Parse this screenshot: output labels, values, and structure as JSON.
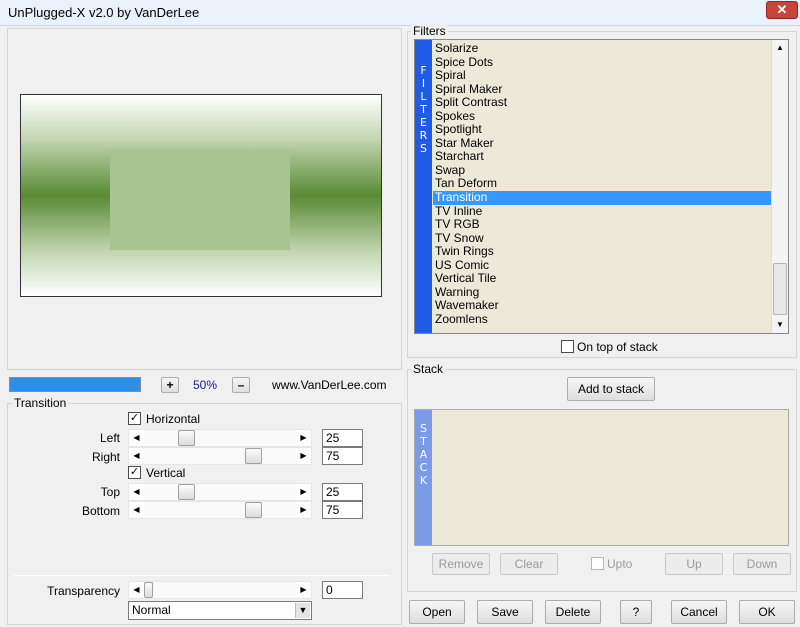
{
  "window": {
    "title": "UnPlugged-X v2.0 by VanDerLee",
    "close_glyph": "✕"
  },
  "preview": {
    "zoom_in": "+",
    "zoom_value": "50%",
    "zoom_out": "–",
    "website": "www.VanDerLee.com"
  },
  "transition_group": {
    "label": "Transition",
    "horizontal": {
      "label": "Horizontal",
      "checked": true
    },
    "vertical": {
      "label": "Vertical",
      "checked": true
    },
    "sliders": [
      {
        "label": "Left",
        "value": "25"
      },
      {
        "label": "Right",
        "value": "75"
      },
      {
        "label": "Top",
        "value": "25"
      },
      {
        "label": "Bottom",
        "value": "75"
      }
    ],
    "transparency": {
      "label": "Transparency",
      "value": "0"
    },
    "blend_mode": "Normal",
    "check_glyph": "✓"
  },
  "filters": {
    "label": "Filters",
    "sidebar_letters": [
      "F",
      "I",
      "L",
      "T",
      "E",
      "R",
      "S"
    ],
    "items": [
      "Solarize",
      "Spice Dots",
      "Spiral",
      "Spiral Maker",
      "Split Contrast",
      "Spokes",
      "Spotlight",
      "Star Maker",
      "Starchart",
      "Swap",
      "Tan Deform",
      "Transition",
      "TV Inline",
      "TV RGB",
      "TV Snow",
      "Twin Rings",
      "US Comic",
      "Vertical Tile",
      "Warning",
      "Wavemaker",
      "Zoomlens"
    ],
    "selected": "Transition",
    "on_top_of_stack": "On top of stack"
  },
  "stack": {
    "label": "Stack",
    "add_button": "Add to stack",
    "sidebar_letters": [
      "S",
      "T",
      "A",
      "C",
      "K"
    ],
    "remove": "Remove",
    "clear": "Clear",
    "upto": "Upto",
    "up": "Up",
    "down": "Down"
  },
  "footer": {
    "open": "Open",
    "save": "Save",
    "delete": "Delete",
    "help": "?",
    "cancel": "Cancel",
    "ok": "OK"
  },
  "colors": {
    "accent_blue": "#1e5be6",
    "selection": "#3399ff",
    "list_bg": "#ece9d8",
    "preview_green_dark": "#5a8a35",
    "preview_green_mid": "#a8c491"
  }
}
